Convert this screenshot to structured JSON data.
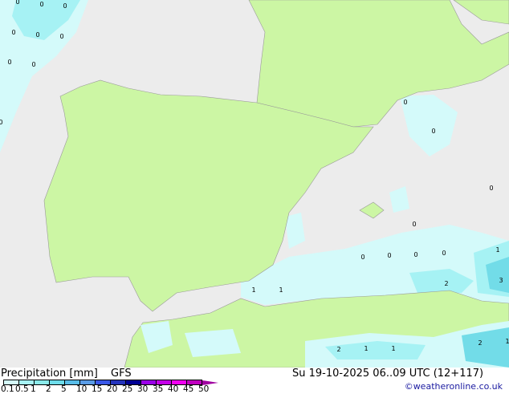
{
  "map": {
    "sea_color": "#ececec",
    "land_color": "#ccf6a4",
    "precip_colors": [
      "#d4fafa",
      "#a6f2f4",
      "#72dce8"
    ],
    "point_values": [
      "0",
      "0",
      "0",
      "0",
      "0",
      "0",
      "0",
      "0",
      "0",
      "0",
      "0",
      "0",
      "0",
      "0",
      "0",
      "0",
      "0",
      "1",
      "1",
      "1",
      "1",
      "1",
      "2",
      "2",
      "2",
      "3",
      "1"
    ]
  },
  "legend": {
    "title": "Precipitation [mm]",
    "model": "GFS",
    "date": "Su 19-10-2025 06..09 UTC (12+117)",
    "credit": "©weatheronline.co.uk",
    "ticks": [
      "0.1",
      "0.5",
      "1",
      "2",
      "5",
      "10",
      "15",
      "20",
      "25",
      "30",
      "35",
      "40",
      "45",
      "50"
    ],
    "colors": [
      "#d4fafa",
      "#a6f2f4",
      "#8aeaea",
      "#6edcea",
      "#58bce8",
      "#5a9ce6",
      "#3a58e8",
      "#2434bc",
      "#000094",
      "#9a00e8",
      "#c400e8",
      "#f000f0",
      "#c000c0",
      "#a000a0"
    ]
  }
}
